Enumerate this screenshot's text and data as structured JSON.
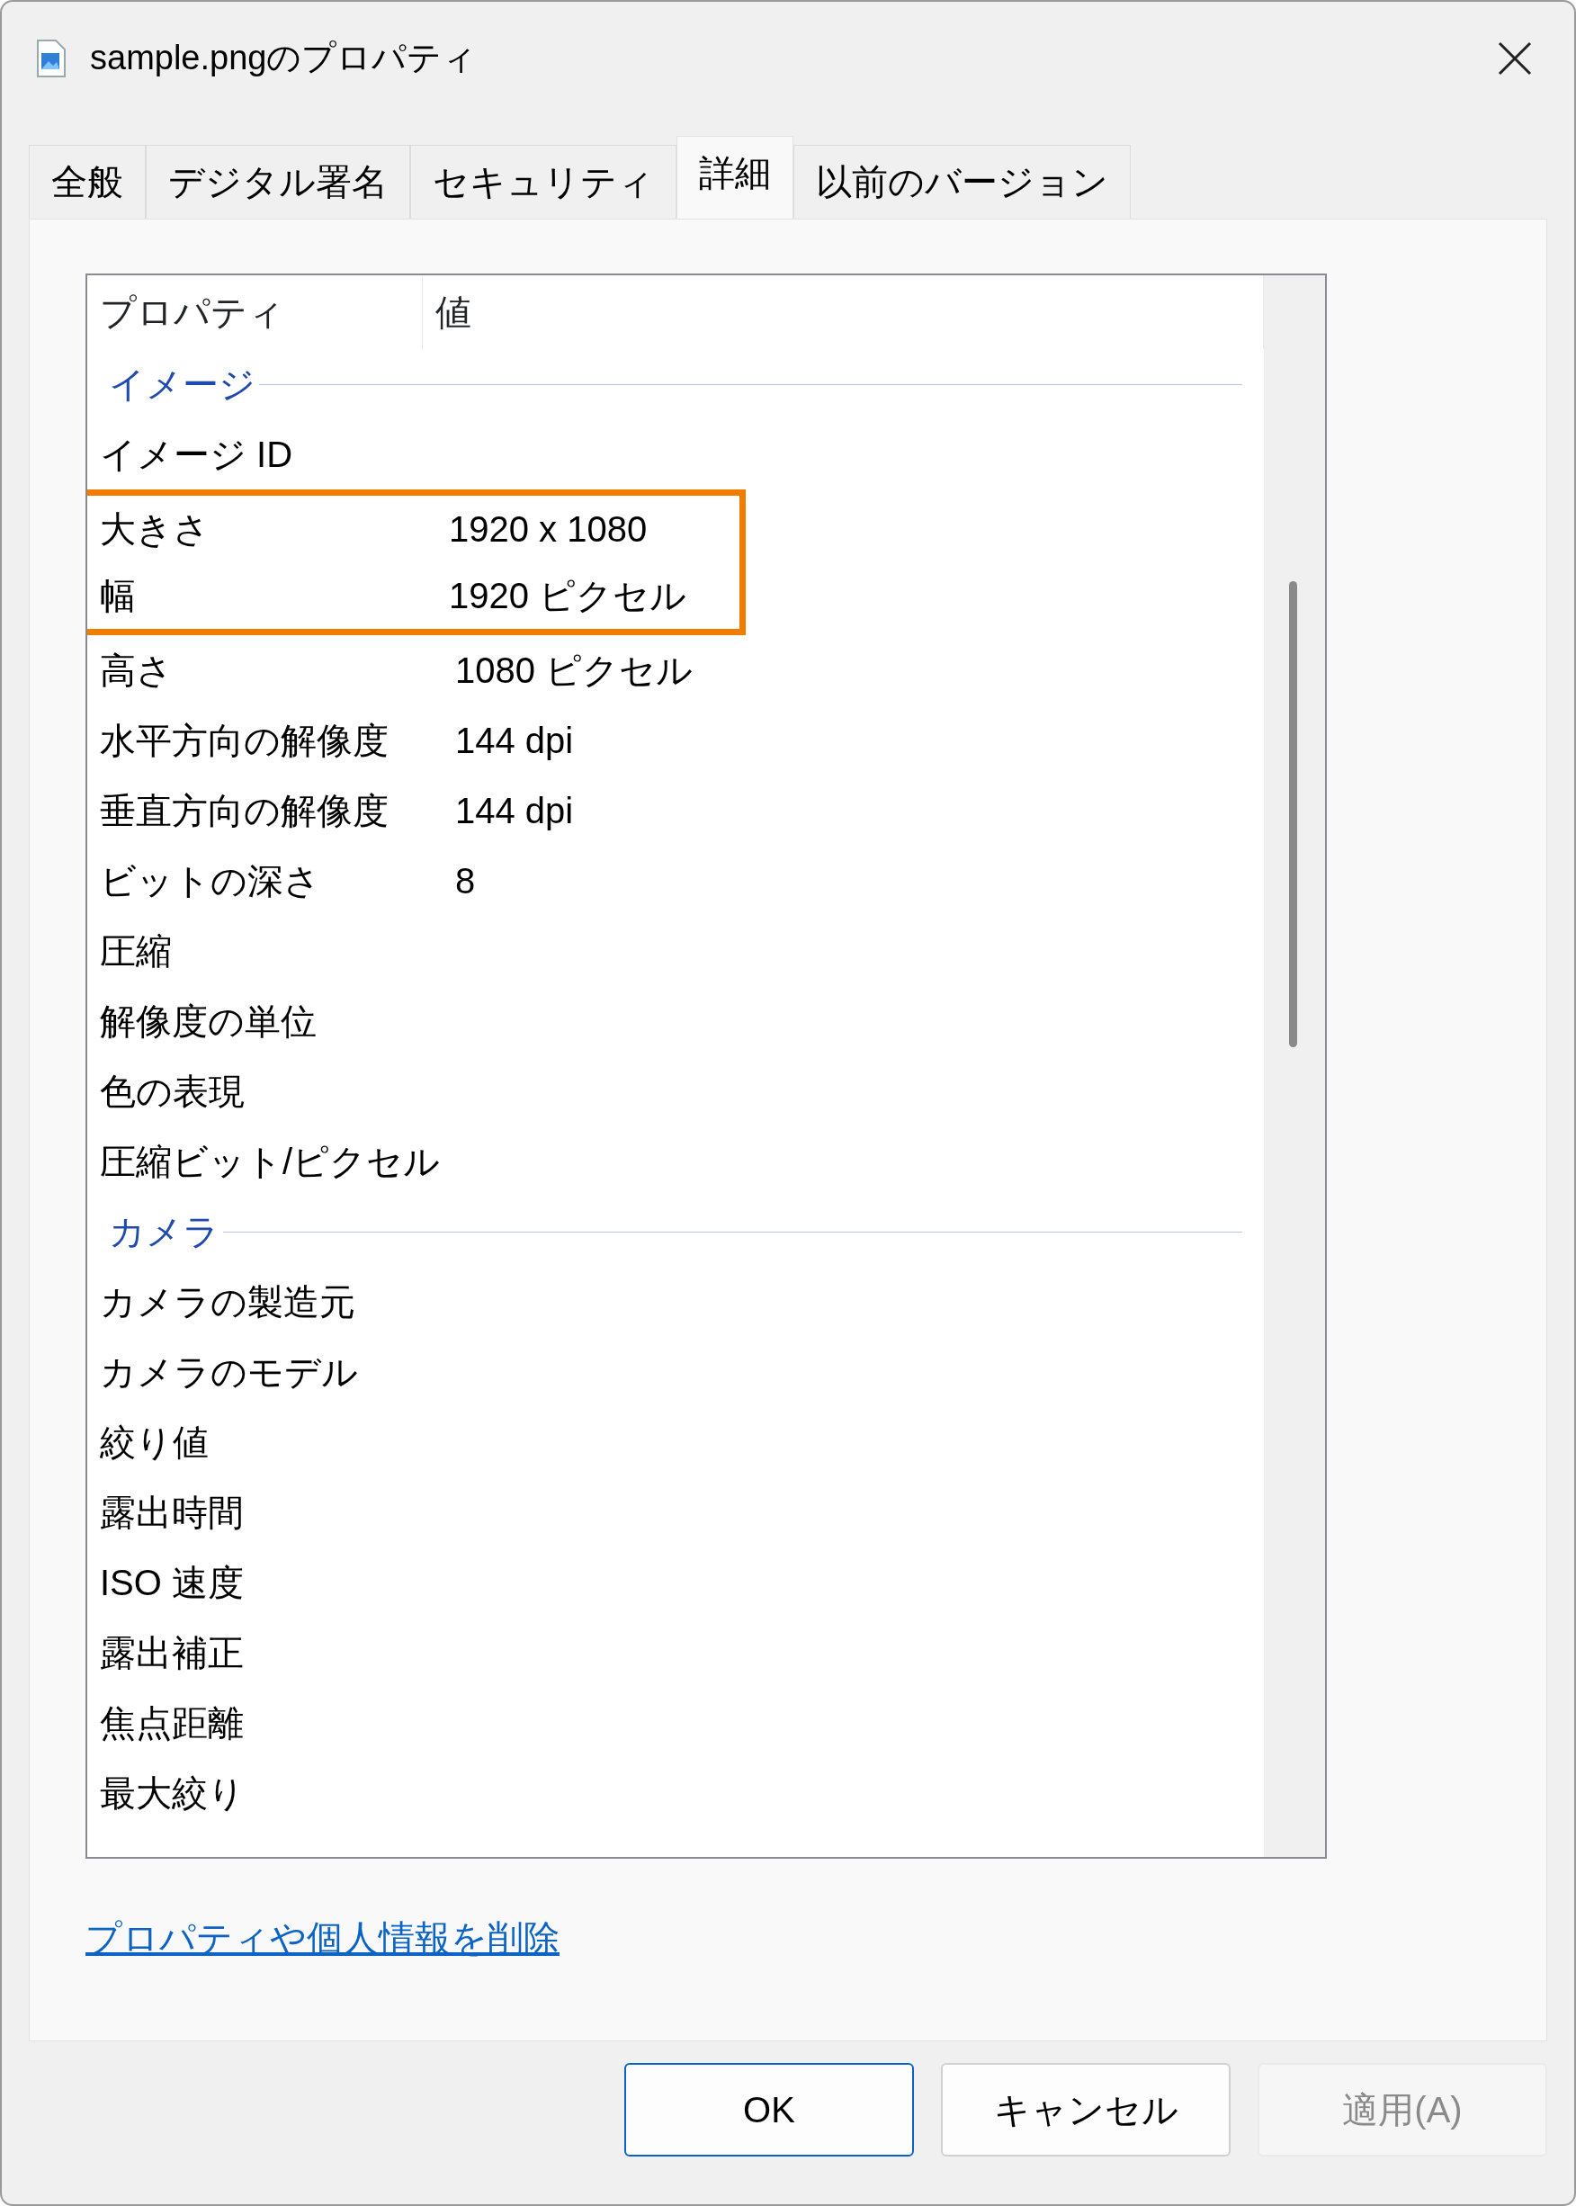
{
  "window": {
    "title": "sample.pngのプロパティ"
  },
  "tabs": [
    {
      "label": "全般",
      "selected": false
    },
    {
      "label": "デジタル署名",
      "selected": false
    },
    {
      "label": "セキュリティ",
      "selected": false
    },
    {
      "label": "詳細",
      "selected": true
    },
    {
      "label": "以前のバージョン",
      "selected": false
    }
  ],
  "list": {
    "columns": [
      "プロパティ",
      "値"
    ],
    "sections": [
      {
        "title": "イメージ",
        "rows": [
          {
            "name": "イメージ ID",
            "highlighted": false
          },
          {
            "name": "大きさ",
            "value": "1920 x 1080",
            "highlighted": true
          },
          {
            "name": "幅",
            "value": "1920 ピクセル",
            "highlighted": true
          },
          {
            "name": "高さ",
            "value": "1080 ピクセル",
            "highlighted": false
          },
          {
            "name": "水平方向の解像度",
            "value": "144 dpi",
            "highlighted": false
          },
          {
            "name": "垂直方向の解像度",
            "value": "144 dpi",
            "highlighted": false
          },
          {
            "name": "ビットの深さ",
            "value": "8",
            "highlighted": false
          },
          {
            "name": "圧縮",
            "highlighted": false
          },
          {
            "name": "解像度の単位",
            "highlighted": false
          },
          {
            "name": "色の表現",
            "highlighted": false
          },
          {
            "name": "圧縮ビット/ピクセル",
            "highlighted": false
          }
        ]
      },
      {
        "title": "カメラ",
        "rows": [
          {
            "name": "カメラの製造元",
            "highlighted": false
          },
          {
            "name": "カメラのモデル",
            "highlighted": false
          },
          {
            "name": "絞り値",
            "highlighted": false
          },
          {
            "name": "露出時間",
            "highlighted": false
          },
          {
            "name": "ISO 速度",
            "highlighted": false
          },
          {
            "name": "露出補正",
            "highlighted": false
          },
          {
            "name": "焦点距離",
            "highlighted": false
          },
          {
            "name": "最大絞り",
            "highlighted": false
          }
        ]
      }
    ]
  },
  "link": "プロパティや個人情報を削除",
  "buttons": [
    {
      "label": "OK",
      "kind": "default",
      "disabled": false
    },
    {
      "label": "キャンセル",
      "kind": "normal",
      "disabled": false
    },
    {
      "label": "適用(A)",
      "kind": "normal",
      "disabled": true
    }
  ]
}
